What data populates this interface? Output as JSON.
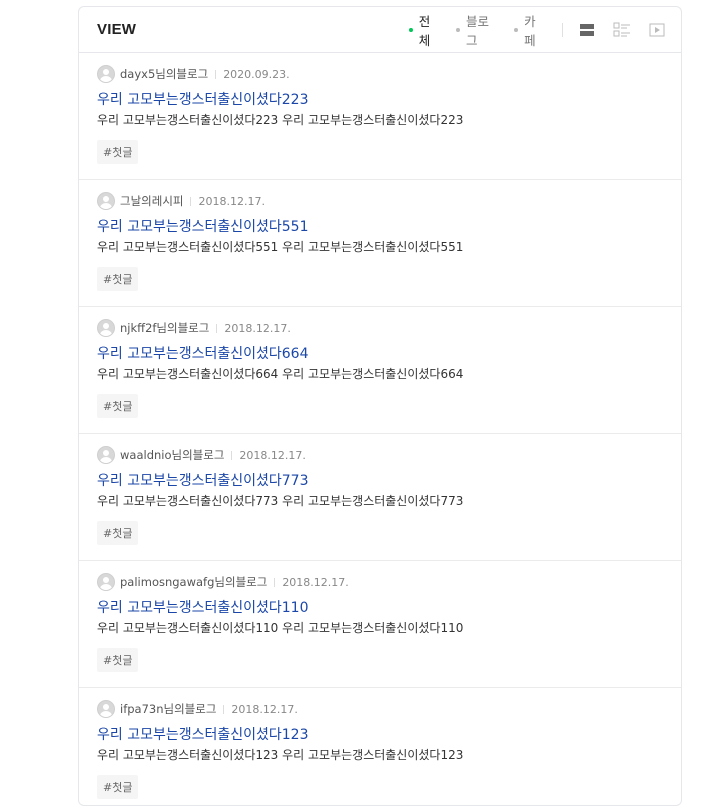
{
  "header": {
    "title": "VIEW",
    "filters": [
      {
        "label": "전체",
        "active": true
      },
      {
        "label": "블로그",
        "active": false
      },
      {
        "label": "카페",
        "active": false
      }
    ],
    "colors": {
      "active_dot": "#03c75a",
      "title_link": "#1b47a8"
    },
    "view_icons": [
      "list-view-icon",
      "thumbnail-view-icon",
      "video-view-icon"
    ]
  },
  "items": [
    {
      "author": "dayx5님의블로그",
      "date": "2020.09.23.",
      "title": "우리 고모부는갱스터출신이셨다223",
      "desc": "우리 고모부는갱스터출신이셨다223 우리 고모부는갱스터출신이셨다223",
      "tag": "#첫글"
    },
    {
      "author": "그날의레시피",
      "date": "2018.12.17.",
      "title": "우리 고모부는갱스터출신이셨다551",
      "desc": "우리 고모부는갱스터출신이셨다551 우리 고모부는갱스터출신이셨다551",
      "tag": "#첫글"
    },
    {
      "author": "njkff2f님의블로그",
      "date": "2018.12.17.",
      "title": "우리 고모부는갱스터출신이셨다664",
      "desc": "우리 고모부는갱스터출신이셨다664 우리 고모부는갱스터출신이셨다664",
      "tag": "#첫글"
    },
    {
      "author": "waaldnio님의블로그",
      "date": "2018.12.17.",
      "title": "우리 고모부는갱스터출신이셨다773",
      "desc": "우리 고모부는갱스터출신이셨다773 우리 고모부는갱스터출신이셨다773",
      "tag": "#첫글"
    },
    {
      "author": "palimosngawafg님의블로그",
      "date": "2018.12.17.",
      "title": "우리 고모부는갱스터출신이셨다110",
      "desc": "우리 고모부는갱스터출신이셨다110 우리 고모부는갱스터출신이셨다110",
      "tag": "#첫글"
    },
    {
      "author": "ifpa73n님의블로그",
      "date": "2018.12.17.",
      "title": "우리 고모부는갱스터출신이셨다123",
      "desc": "우리 고모부는갱스터출신이셨다123 우리 고모부는갱스터출신이셨다123",
      "tag": "#첫글"
    }
  ]
}
